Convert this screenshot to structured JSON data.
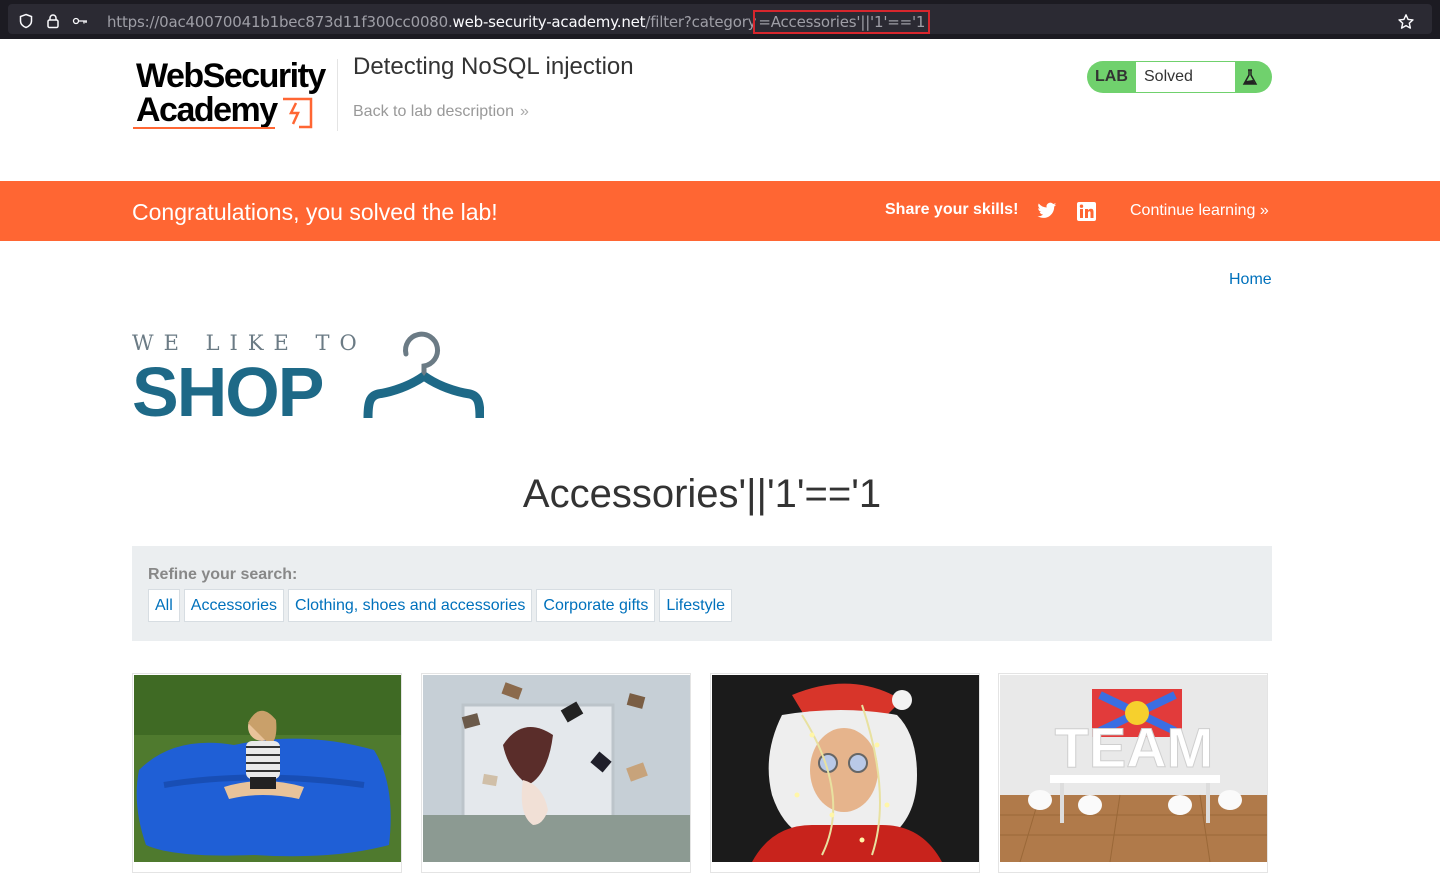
{
  "browser": {
    "url_prefix": "https://0ac40070041b1bec873d11f300cc0080.",
    "url_domain": "web-security-academy.net",
    "url_path": "/filter?category",
    "url_highlight": "=Accessories'||'1'=='1"
  },
  "lab": {
    "logo_line1": "WebSecurity",
    "logo_line2": "Academy",
    "title": "Detecting NoSQL injection",
    "back_link": "Back to lab description",
    "status_prefix": "LAB",
    "status": "Solved"
  },
  "banner": {
    "message": "Congratulations, you solved the lab!",
    "share": "Share your skills!",
    "continue": "Continue learning"
  },
  "nav": {
    "home": "Home"
  },
  "shop": {
    "tagline": "WE LIKE TO",
    "name": "SHOP"
  },
  "category_title": "Accessories'||'1'=='1",
  "refine": {
    "label": "Refine your search:",
    "filters": [
      "All",
      "Accessories",
      "Clothing, shoes and accessories",
      "Corporate gifts",
      "Lifestyle"
    ]
  },
  "products": [
    {
      "image": "child-on-blue-beanbag"
    },
    {
      "image": "flying-books-bedroom"
    },
    {
      "image": "santa-with-fairy-lights"
    },
    {
      "image": "team-sign-conference-room"
    }
  ],
  "colors": {
    "accent": "#ff6633",
    "link": "#0071bc",
    "solved": "#70d16d",
    "shop_blue": "#1e6987"
  }
}
